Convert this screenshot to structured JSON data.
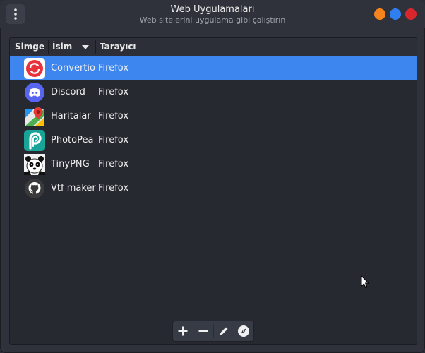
{
  "window": {
    "title": "Web Uygulamaları",
    "subtitle": "Web sitelerini uygulama gibi çalıştırın"
  },
  "table": {
    "columns": [
      "Simge",
      "İsim",
      "Tarayıcı"
    ],
    "sort_column": "İsim",
    "rows": [
      {
        "name": "Convertio",
        "browser": "Firefox",
        "icon": "convertio-icon",
        "selected": true
      },
      {
        "name": "Discord",
        "browser": "Firefox",
        "icon": "discord-icon",
        "selected": false
      },
      {
        "name": "Haritalar",
        "browser": "Firefox",
        "icon": "maps-icon",
        "selected": false
      },
      {
        "name": "PhotoPea",
        "browser": "Firefox",
        "icon": "photopea-icon",
        "selected": false
      },
      {
        "name": "TinyPNG",
        "browser": "Firefox",
        "icon": "tinypng-icon",
        "selected": false
      },
      {
        "name": "Vtf maker",
        "browser": "Firefox",
        "icon": "github-icon",
        "selected": false
      }
    ]
  },
  "toolbar": {
    "buttons": [
      "add-icon",
      "remove-icon",
      "edit-icon",
      "browse-icon"
    ]
  },
  "colors": {
    "selection": "#3d86f0",
    "minimize": "#f5841f",
    "maximize": "#2f7ff0",
    "close": "#d9262d"
  }
}
